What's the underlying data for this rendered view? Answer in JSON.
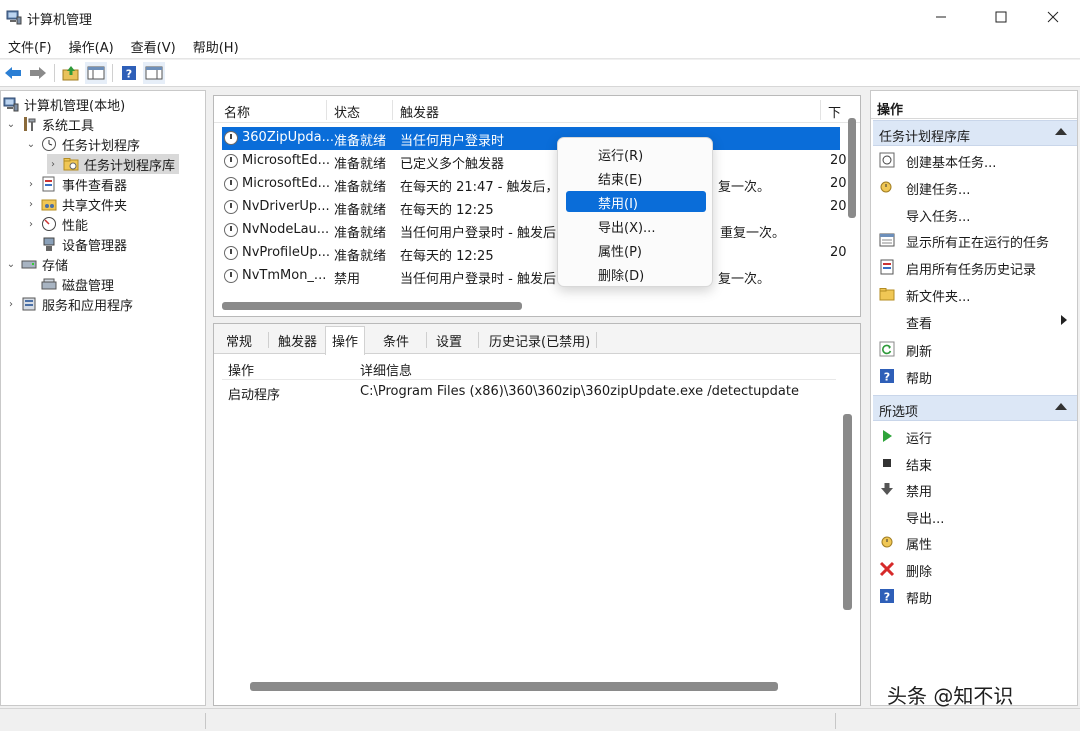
{
  "window": {
    "title": "计算机管理",
    "minimize_icon": "minimize-icon",
    "maximize_icon": "maximize-icon",
    "close_icon": "close-icon"
  },
  "menubar": [
    "文件(F)",
    "操作(A)",
    "查看(V)",
    "帮助(H)"
  ],
  "toolbar": [
    "back-arrow-icon",
    "forward-arrow-icon",
    "up-folder-icon",
    "show-pane-icon",
    "help-icon",
    "hide-pane-icon"
  ],
  "tree": {
    "items": [
      {
        "label": "计算机管理(本地)",
        "icon": "computer-icon",
        "arrow": ""
      },
      {
        "label": "系统工具",
        "icon": "tools-icon",
        "arrow": "expanded"
      },
      {
        "label": "任务计划程序",
        "icon": "clock-icon",
        "arrow": "expanded"
      },
      {
        "label": "任务计划程序库",
        "icon": "folder-icon",
        "arrow": "collapsed"
      },
      {
        "label": "事件查看器",
        "icon": "event-viewer-icon",
        "arrow": "collapsed"
      },
      {
        "label": "共享文件夹",
        "icon": "shared-folder-icon",
        "arrow": "collapsed"
      },
      {
        "label": "性能",
        "icon": "performance-icon",
        "arrow": "collapsed"
      },
      {
        "label": "设备管理器",
        "icon": "device-manager-icon",
        "arrow": ""
      },
      {
        "label": "存储",
        "icon": "storage-icon",
        "arrow": "expanded"
      },
      {
        "label": "磁盘管理",
        "icon": "disk-icon",
        "arrow": ""
      },
      {
        "label": "服务和应用程序",
        "icon": "services-icon",
        "arrow": "collapsed"
      }
    ]
  },
  "task_list": {
    "columns": [
      "名称",
      "状态",
      "触发器",
      "下"
    ],
    "rows": [
      {
        "name": "360ZipUpda...",
        "status": "准备就绪",
        "trigger": "当任何用户登录时",
        "next": "",
        "selected": true
      },
      {
        "name": "MicrosoftEd...",
        "status": "准备就绪",
        "trigger": "已定义多个触发器",
        "next": "20"
      },
      {
        "name": "MicrosoftEd...",
        "status": "准备就绪",
        "trigger": "在每天的 21:47 - 触发后，",
        "trigger_tail": "复一次。",
        "next": "20"
      },
      {
        "name": "NvDriverUp...",
        "status": "准备就绪",
        "trigger": "在每天的 12:25",
        "next": "20"
      },
      {
        "name": "NvNodeLau...",
        "status": "准备就绪",
        "trigger": "当任何用户登录时 - 触发后",
        "trigger_tail": "重复一次。",
        "next": ""
      },
      {
        "name": "NvProfileUp...",
        "status": "准备就绪",
        "trigger": "在每天的 12:25",
        "next": "20"
      },
      {
        "name": "NvTmMon_...",
        "status": "禁用",
        "trigger": "当任何用户登录时 - 触发后",
        "trigger_tail": "复一次。",
        "next": ""
      }
    ]
  },
  "context_menu": {
    "items": [
      "运行(R)",
      "结束(E)",
      "禁用(I)",
      "导出(X)...",
      "属性(P)",
      "删除(D)"
    ],
    "highlighted_index": 2
  },
  "details": {
    "tabs": [
      "常规",
      "触发器",
      "操作",
      "条件",
      "设置",
      "历史记录(已禁用)"
    ],
    "active_tab": "操作",
    "columns": [
      "操作",
      "详细信息"
    ],
    "rows": [
      {
        "action": "启动程序",
        "detail": "C:\\Program Files (x86)\\360\\360zip\\360zipUpdate.exe /detectupdate"
      }
    ]
  },
  "actions_pane": {
    "title": "操作",
    "section1": {
      "title": "任务计划程序库",
      "items": [
        {
          "label": "创建基本任务...",
          "icon": "create-basic-task-icon"
        },
        {
          "label": "创建任务...",
          "icon": "create-task-icon"
        },
        {
          "label": "导入任务...",
          "icon": ""
        },
        {
          "label": "显示所有正在运行的任务",
          "icon": "running-tasks-icon"
        },
        {
          "label": "启用所有任务历史记录",
          "icon": "history-icon"
        },
        {
          "label": "新文件夹...",
          "icon": "new-folder-icon"
        },
        {
          "label": "查看",
          "icon": "",
          "submenu": true
        },
        {
          "label": "刷新",
          "icon": "refresh-icon"
        },
        {
          "label": "帮助",
          "icon": "help-icon"
        }
      ]
    },
    "section2": {
      "title": "所选项",
      "items": [
        {
          "label": "运行",
          "icon": "run-icon"
        },
        {
          "label": "结束",
          "icon": "end-icon"
        },
        {
          "label": "禁用",
          "icon": "disable-icon"
        },
        {
          "label": "导出...",
          "icon": ""
        },
        {
          "label": "属性",
          "icon": "properties-icon"
        },
        {
          "label": "删除",
          "icon": "delete-icon"
        },
        {
          "label": "帮助",
          "icon": "help-icon"
        }
      ]
    }
  },
  "watermark": "头条 @知不识",
  "colors": {
    "selection": "#0a6dd9",
    "section_header": "#dce7f6"
  }
}
